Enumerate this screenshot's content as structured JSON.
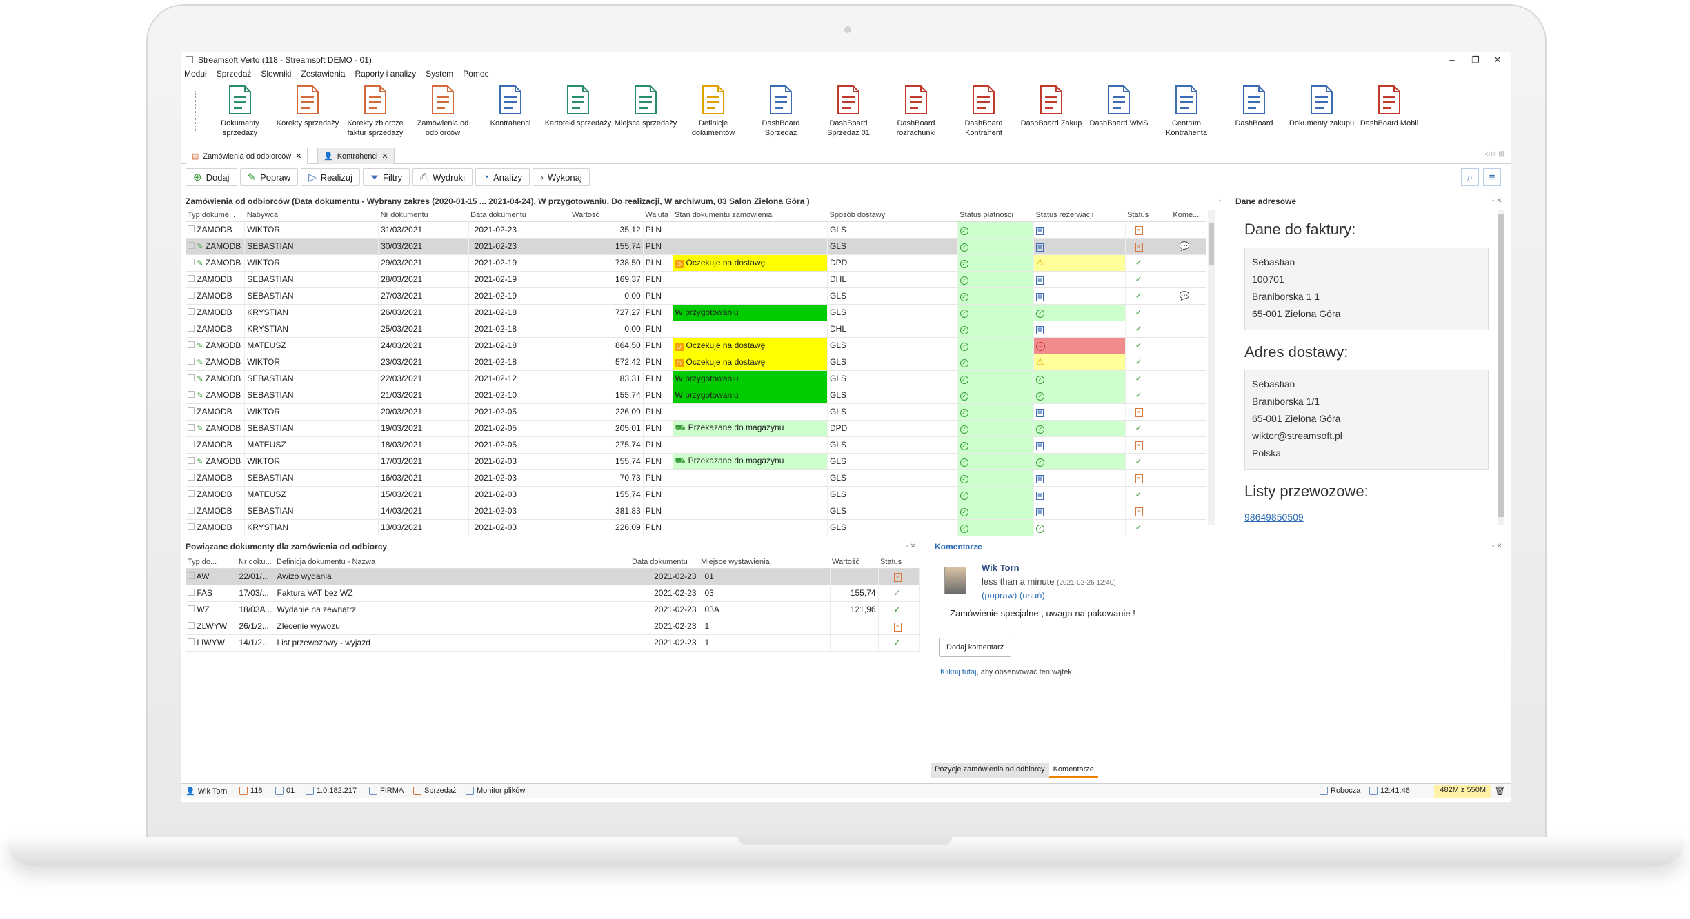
{
  "window": {
    "title": "Streamsoft Verto (118 - Streamsoft DEMO - 01)",
    "min": "–",
    "restore": "❐",
    "close": "✕"
  },
  "menu": [
    "Moduł",
    "Sprzedaż",
    "Słowniki",
    "Zestawienia",
    "Raporty i analizy",
    "System",
    "Pomoc"
  ],
  "ribbon": [
    {
      "label": "Dokumenty sprzedaży",
      "icon": "sales-documents-icon",
      "color": "#2a8c6e"
    },
    {
      "label": "Korekty sprzedaży",
      "icon": "sales-corrections-icon",
      "color": "#d36a3a"
    },
    {
      "label": "Korekty zbiorcze faktur sprzedaży",
      "icon": "collective-corrections-icon",
      "color": "#d36a3a"
    },
    {
      "label": "Zamówienia od odbiorców",
      "icon": "customer-orders-icon",
      "color": "#d36a3a"
    },
    {
      "label": "Kontrahenci",
      "icon": "contractors-icon",
      "color": "#3b6cb5"
    },
    {
      "label": "Kartoteki sprzedaży",
      "icon": "sales-records-icon",
      "color": "#2a8c6e"
    },
    {
      "label": "Miejsca sprzedaży",
      "icon": "sales-places-icon",
      "color": "#2a8c6e"
    },
    {
      "label": "Definicje dokumentów",
      "icon": "document-definitions-icon",
      "color": "#e0a000"
    },
    {
      "label": "DashBoard Sprzedaż",
      "icon": "dashboard-sales-icon",
      "color": "#3b6cb5"
    },
    {
      "label": "DashBoard Sprzedaż 01",
      "icon": "dashboard-store-icon",
      "color": "#c0392b"
    },
    {
      "label": "DashBoard rozrachunki",
      "icon": "dashboard-settlements-icon",
      "color": "#c0392b"
    },
    {
      "label": "DashBoard Kontrahent",
      "icon": "dashboard-contractor-icon",
      "color": "#c0392b"
    },
    {
      "label": "DashBoard Zakup",
      "icon": "dashboard-purchase-icon",
      "color": "#c0392b"
    },
    {
      "label": "DashBoard WMS",
      "icon": "dashboard-wms-icon",
      "color": "#3b6cb5"
    },
    {
      "label": "Centrum Kontrahenta",
      "icon": "contractor-center-icon",
      "color": "#3b6cb5"
    },
    {
      "label": "DashBoard",
      "icon": "dashboard-icon",
      "color": "#3b6cb5"
    },
    {
      "label": "Dokumenty zakupu",
      "icon": "purchase-documents-icon",
      "color": "#3b6cb5"
    },
    {
      "label": "DashBoard Mobil",
      "icon": "dashboard-mobile-icon",
      "color": "#c0392b"
    }
  ],
  "tabs": [
    {
      "label": "Zamówienia od odbiorców",
      "close": "✕"
    },
    {
      "label": "Kontrahenci",
      "close": "✕"
    }
  ],
  "tab_nav": "◁ ▷ ▥",
  "toolbar": {
    "add": "Dodaj",
    "edit": "Popraw",
    "realize": "Realizuj",
    "filters": "Filtry",
    "prints": "Wydruki",
    "analyses": "Analizy",
    "execute": "Wykonaj"
  },
  "orders": {
    "title": "Zamówienia od odbiorców (Data dokumentu - Wybrany zakres (2020-01-15 ... 2021-04-24), W przygotowaniu, Do realizacji, W archiwum, 03 Salon Zielona Góra )",
    "columns": [
      "Typ dokume...",
      "Nabywca",
      "Nr dokumentu",
      "Data dokumentu",
      "Wartość",
      "Waluta",
      "Stan dokumentu zamówienia",
      "Sposób dostawy",
      "Status płatności",
      "Status rezerwacji",
      "Status",
      "Kome..."
    ],
    "rows": [
      {
        "edit": false,
        "type": "ZAMODB",
        "buyer": "WIKTOR",
        "nr": "31/03/2021",
        "date": "2021-02-23",
        "value": "35,12",
        "cur": "PLN",
        "state": "",
        "state_style": "",
        "delivery": "GLS",
        "rez": "doc",
        "rez_style": "",
        "status": "doc",
        "comment": false
      },
      {
        "edit": true,
        "type": "ZAMODB",
        "buyer": "SEBASTIAN",
        "nr": "30/03/2021",
        "date": "2021-02-23",
        "value": "155,74",
        "cur": "PLN",
        "state": "",
        "state_style": "",
        "delivery": "GLS",
        "rez": "doc",
        "rez_style": "",
        "status": "doc",
        "comment": true
      },
      {
        "edit": true,
        "type": "ZAMODB",
        "buyer": "WIKTOR",
        "nr": "29/03/2021",
        "date": "2021-02-19",
        "value": "738,50",
        "cur": "PLN",
        "state": "Oczekuje na dostawę",
        "state_style": "yellow",
        "delivery": "DPD",
        "rez": "warn",
        "rez_style": "paleyellow",
        "status": "check",
        "comment": false
      },
      {
        "edit": false,
        "type": "ZAMODB",
        "buyer": "SEBASTIAN",
        "nr": "28/03/2021",
        "date": "2021-02-19",
        "value": "169,37",
        "cur": "PLN",
        "state": "",
        "state_style": "",
        "delivery": "DHL",
        "rez": "doc",
        "rez_style": "",
        "status": "check",
        "comment": false
      },
      {
        "edit": false,
        "type": "ZAMODB",
        "buyer": "SEBASTIAN",
        "nr": "27/03/2021",
        "date": "2021-02-19",
        "value": "0,00",
        "cur": "PLN",
        "state": "",
        "state_style": "",
        "delivery": "GLS",
        "rez": "doc",
        "rez_style": "",
        "status": "check",
        "comment": true
      },
      {
        "edit": false,
        "type": "ZAMODB",
        "buyer": "KRYSTIAN",
        "nr": "26/03/2021",
        "date": "2021-02-18",
        "value": "727,27",
        "cur": "PLN",
        "state": "W przygotowaniu",
        "state_style": "green",
        "delivery": "GLS",
        "rez": "ok",
        "rez_style": "light",
        "status": "check",
        "comment": false
      },
      {
        "edit": false,
        "type": "ZAMODB",
        "buyer": "KRYSTIAN",
        "nr": "25/03/2021",
        "date": "2021-02-18",
        "value": "0,00",
        "cur": "PLN",
        "state": "",
        "state_style": "",
        "delivery": "DHL",
        "rez": "doc",
        "rez_style": "",
        "status": "check",
        "comment": false
      },
      {
        "edit": true,
        "type": "ZAMODB",
        "buyer": "MATEUSZ",
        "nr": "24/03/2021",
        "date": "2021-02-18",
        "value": "864,50",
        "cur": "PLN",
        "state": "Oczekuje na dostawę",
        "state_style": "yellow",
        "delivery": "GLS",
        "rez": "stop",
        "rez_style": "red",
        "status": "check",
        "comment": false
      },
      {
        "edit": true,
        "type": "ZAMODB",
        "buyer": "WIKTOR",
        "nr": "23/03/2021",
        "date": "2021-02-18",
        "value": "572,42",
        "cur": "PLN",
        "state": "Oczekuje na dostawę",
        "state_style": "yellow",
        "delivery": "GLS",
        "rez": "warn",
        "rez_style": "paleyellow",
        "status": "check",
        "comment": false
      },
      {
        "edit": true,
        "type": "ZAMODB",
        "buyer": "SEBASTIAN",
        "nr": "22/03/2021",
        "date": "2021-02-12",
        "value": "83,31",
        "cur": "PLN",
        "state": "W przygotowaniu",
        "state_style": "green",
        "delivery": "GLS",
        "rez": "ok",
        "rez_style": "light",
        "status": "check",
        "comment": false
      },
      {
        "edit": true,
        "type": "ZAMODB",
        "buyer": "SEBASTIAN",
        "nr": "21/03/2021",
        "date": "2021-02-10",
        "value": "155,74",
        "cur": "PLN",
        "state": "W przygotowaniu",
        "state_style": "green",
        "delivery": "GLS",
        "rez": "ok",
        "rez_style": "light",
        "status": "check",
        "comment": false
      },
      {
        "edit": false,
        "type": "ZAMODB",
        "buyer": "WIKTOR",
        "nr": "20/03/2021",
        "date": "2021-02-05",
        "value": "226,09",
        "cur": "PLN",
        "state": "",
        "state_style": "",
        "delivery": "GLS",
        "rez": "doc",
        "rez_style": "",
        "status": "doc",
        "comment": false
      },
      {
        "edit": true,
        "type": "ZAMODB",
        "buyer": "SEBASTIAN",
        "nr": "19/03/2021",
        "date": "2021-02-05",
        "value": "205,01",
        "cur": "PLN",
        "state": "Przekazane do magazynu",
        "state_style": "light",
        "delivery": "DPD",
        "rez": "ok",
        "rez_style": "light",
        "status": "check",
        "comment": false
      },
      {
        "edit": false,
        "type": "ZAMODB",
        "buyer": "MATEUSZ",
        "nr": "18/03/2021",
        "date": "2021-02-05",
        "value": "275,74",
        "cur": "PLN",
        "state": "",
        "state_style": "",
        "delivery": "GLS",
        "rez": "doc",
        "rez_style": "",
        "status": "doc",
        "comment": false
      },
      {
        "edit": true,
        "type": "ZAMODB",
        "buyer": "WIKTOR",
        "nr": "17/03/2021",
        "date": "2021-02-03",
        "value": "155,74",
        "cur": "PLN",
        "state": "Przekazane do magazynu",
        "state_style": "light",
        "delivery": "GLS",
        "rez": "ok",
        "rez_style": "light",
        "status": "check",
        "comment": false
      },
      {
        "edit": false,
        "type": "ZAMODB",
        "buyer": "SEBASTIAN",
        "nr": "16/03/2021",
        "date": "2021-02-03",
        "value": "70,73",
        "cur": "PLN",
        "state": "",
        "state_style": "",
        "delivery": "GLS",
        "rez": "doc",
        "rez_style": "",
        "status": "doc",
        "comment": false
      },
      {
        "edit": false,
        "type": "ZAMODB",
        "buyer": "MATEUSZ",
        "nr": "15/03/2021",
        "date": "2021-02-03",
        "value": "155,74",
        "cur": "PLN",
        "state": "",
        "state_style": "",
        "delivery": "GLS",
        "rez": "doc",
        "rez_style": "",
        "status": "check",
        "comment": false
      },
      {
        "edit": false,
        "type": "ZAMODB",
        "buyer": "SEBASTIAN",
        "nr": "14/03/2021",
        "date": "2021-02-03",
        "value": "381,83",
        "cur": "PLN",
        "state": "",
        "state_style": "",
        "delivery": "GLS",
        "rez": "doc",
        "rez_style": "",
        "status": "doc",
        "comment": false
      },
      {
        "edit": false,
        "type": "ZAMODB",
        "buyer": "KRYSTIAN",
        "nr": "13/03/2021",
        "date": "2021-02-03",
        "value": "226,09",
        "cur": "PLN",
        "state": "",
        "state_style": "",
        "delivery": "GLS",
        "rez": "ok",
        "rez_style": "",
        "status": "check",
        "comment": false
      }
    ],
    "selected_row": 1
  },
  "address": {
    "panel_title": "Dane adresowe",
    "invoice_title": "Dane do faktury:",
    "invoice_lines": [
      "Sebastian",
      "100701",
      "Braniborska 1 1",
      "65-001 Zielona Góra"
    ],
    "delivery_title": "Adres dostawy:",
    "delivery_lines": [
      "Sebastian",
      "Braniborska 1/1",
      "65-001 Zielona Góra",
      "wiktor@streamsoft.pl",
      "Polska"
    ],
    "waybills_title": "Listy przewozowe:",
    "waybill_link": "98649850509"
  },
  "related": {
    "title": "Powiązane dokumenty dla zamówienia od odbiorcy",
    "columns": [
      "Typ do...",
      "Nr doku...",
      "Definicja dokumentu - Nazwa",
      "Data dokumentu",
      "Miejsce wystawienia",
      "Wartość",
      "Status"
    ],
    "rows": [
      {
        "type": "AW",
        "nr": "22/01/...",
        "def": "Awizo wydania",
        "date": "2021-02-23",
        "place": "01",
        "value": "",
        "status": "doc"
      },
      {
        "type": "FAS",
        "nr": "17/03/...",
        "def": "Faktura VAT bez WZ",
        "date": "2021-02-23",
        "place": "03",
        "value": "155,74",
        "status": "check"
      },
      {
        "type": "WZ",
        "nr": "18/03A...",
        "def": "Wydanie na zewnątrz",
        "date": "2021-02-23",
        "place": "03A",
        "value": "121,96",
        "status": "check"
      },
      {
        "type": "ZLWYW",
        "nr": "26/1/2...",
        "def": "Zlecenie wywozu",
        "date": "2021-02-23",
        "place": "1",
        "value": "",
        "status": "doc"
      },
      {
        "type": "LIWYW",
        "nr": "14/1/2...",
        "def": "List przewozowy - wyjazd",
        "date": "2021-02-23",
        "place": "1",
        "value": "",
        "status": "check"
      }
    ]
  },
  "comments": {
    "title": "Komentarze",
    "author": "Wik Torn",
    "when": "less than a minute",
    "stamp": "(2021-02-26 12:40)",
    "edit": "(popraw)",
    "delete": "(usuń)",
    "text": "Zamówienie specjalne , uwaga na pakowanie !",
    "add_button": "Dodaj komentarz",
    "follow_link": "Kliknij tutaj,",
    "follow_rest": " aby obserwować ten wątek.",
    "bottom_tabs": [
      "Pozycje zamówienia od odbiorcy",
      "Komentarze"
    ]
  },
  "status_bar": {
    "user": "Wik Torn",
    "company": "118",
    "branch": "01",
    "ip": "1.0.182.217",
    "firm": "FIRMA",
    "module": "Sprzedaż",
    "monitor": "Monitor plików",
    "mode": "Robocza",
    "time": "12:41:46",
    "memory": "482M z 550M"
  },
  "colors": {
    "accent": "#2d6db5",
    "yellow": "#ffff00",
    "green": "#00cc00",
    "light_green": "#ccffcc",
    "red": "#f08c8c"
  }
}
